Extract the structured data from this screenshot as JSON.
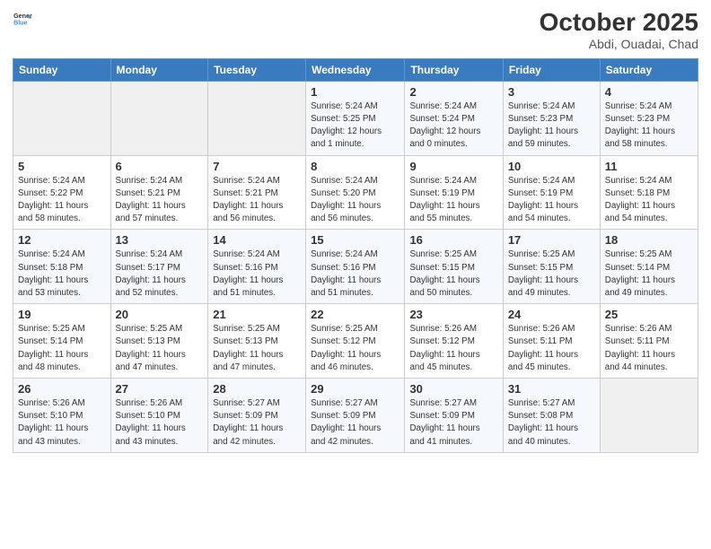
{
  "header": {
    "logo_general": "General",
    "logo_blue": "Blue",
    "month_title": "October 2025",
    "subtitle": "Abdi, Ouadai, Chad"
  },
  "weekdays": [
    "Sunday",
    "Monday",
    "Tuesday",
    "Wednesday",
    "Thursday",
    "Friday",
    "Saturday"
  ],
  "weeks": [
    [
      {
        "day": "",
        "info": ""
      },
      {
        "day": "",
        "info": ""
      },
      {
        "day": "",
        "info": ""
      },
      {
        "day": "1",
        "info": "Sunrise: 5:24 AM\nSunset: 5:25 PM\nDaylight: 12 hours\nand 1 minute."
      },
      {
        "day": "2",
        "info": "Sunrise: 5:24 AM\nSunset: 5:24 PM\nDaylight: 12 hours\nand 0 minutes."
      },
      {
        "day": "3",
        "info": "Sunrise: 5:24 AM\nSunset: 5:23 PM\nDaylight: 11 hours\nand 59 minutes."
      },
      {
        "day": "4",
        "info": "Sunrise: 5:24 AM\nSunset: 5:23 PM\nDaylight: 11 hours\nand 58 minutes."
      }
    ],
    [
      {
        "day": "5",
        "info": "Sunrise: 5:24 AM\nSunset: 5:22 PM\nDaylight: 11 hours\nand 58 minutes."
      },
      {
        "day": "6",
        "info": "Sunrise: 5:24 AM\nSunset: 5:21 PM\nDaylight: 11 hours\nand 57 minutes."
      },
      {
        "day": "7",
        "info": "Sunrise: 5:24 AM\nSunset: 5:21 PM\nDaylight: 11 hours\nand 56 minutes."
      },
      {
        "day": "8",
        "info": "Sunrise: 5:24 AM\nSunset: 5:20 PM\nDaylight: 11 hours\nand 56 minutes."
      },
      {
        "day": "9",
        "info": "Sunrise: 5:24 AM\nSunset: 5:19 PM\nDaylight: 11 hours\nand 55 minutes."
      },
      {
        "day": "10",
        "info": "Sunrise: 5:24 AM\nSunset: 5:19 PM\nDaylight: 11 hours\nand 54 minutes."
      },
      {
        "day": "11",
        "info": "Sunrise: 5:24 AM\nSunset: 5:18 PM\nDaylight: 11 hours\nand 54 minutes."
      }
    ],
    [
      {
        "day": "12",
        "info": "Sunrise: 5:24 AM\nSunset: 5:18 PM\nDaylight: 11 hours\nand 53 minutes."
      },
      {
        "day": "13",
        "info": "Sunrise: 5:24 AM\nSunset: 5:17 PM\nDaylight: 11 hours\nand 52 minutes."
      },
      {
        "day": "14",
        "info": "Sunrise: 5:24 AM\nSunset: 5:16 PM\nDaylight: 11 hours\nand 51 minutes."
      },
      {
        "day": "15",
        "info": "Sunrise: 5:24 AM\nSunset: 5:16 PM\nDaylight: 11 hours\nand 51 minutes."
      },
      {
        "day": "16",
        "info": "Sunrise: 5:25 AM\nSunset: 5:15 PM\nDaylight: 11 hours\nand 50 minutes."
      },
      {
        "day": "17",
        "info": "Sunrise: 5:25 AM\nSunset: 5:15 PM\nDaylight: 11 hours\nand 49 minutes."
      },
      {
        "day": "18",
        "info": "Sunrise: 5:25 AM\nSunset: 5:14 PM\nDaylight: 11 hours\nand 49 minutes."
      }
    ],
    [
      {
        "day": "19",
        "info": "Sunrise: 5:25 AM\nSunset: 5:14 PM\nDaylight: 11 hours\nand 48 minutes."
      },
      {
        "day": "20",
        "info": "Sunrise: 5:25 AM\nSunset: 5:13 PM\nDaylight: 11 hours\nand 47 minutes."
      },
      {
        "day": "21",
        "info": "Sunrise: 5:25 AM\nSunset: 5:13 PM\nDaylight: 11 hours\nand 47 minutes."
      },
      {
        "day": "22",
        "info": "Sunrise: 5:25 AM\nSunset: 5:12 PM\nDaylight: 11 hours\nand 46 minutes."
      },
      {
        "day": "23",
        "info": "Sunrise: 5:26 AM\nSunset: 5:12 PM\nDaylight: 11 hours\nand 45 minutes."
      },
      {
        "day": "24",
        "info": "Sunrise: 5:26 AM\nSunset: 5:11 PM\nDaylight: 11 hours\nand 45 minutes."
      },
      {
        "day": "25",
        "info": "Sunrise: 5:26 AM\nSunset: 5:11 PM\nDaylight: 11 hours\nand 44 minutes."
      }
    ],
    [
      {
        "day": "26",
        "info": "Sunrise: 5:26 AM\nSunset: 5:10 PM\nDaylight: 11 hours\nand 43 minutes."
      },
      {
        "day": "27",
        "info": "Sunrise: 5:26 AM\nSunset: 5:10 PM\nDaylight: 11 hours\nand 43 minutes."
      },
      {
        "day": "28",
        "info": "Sunrise: 5:27 AM\nSunset: 5:09 PM\nDaylight: 11 hours\nand 42 minutes."
      },
      {
        "day": "29",
        "info": "Sunrise: 5:27 AM\nSunset: 5:09 PM\nDaylight: 11 hours\nand 42 minutes."
      },
      {
        "day": "30",
        "info": "Sunrise: 5:27 AM\nSunset: 5:09 PM\nDaylight: 11 hours\nand 41 minutes."
      },
      {
        "day": "31",
        "info": "Sunrise: 5:27 AM\nSunset: 5:08 PM\nDaylight: 11 hours\nand 40 minutes."
      },
      {
        "day": "",
        "info": ""
      }
    ]
  ]
}
